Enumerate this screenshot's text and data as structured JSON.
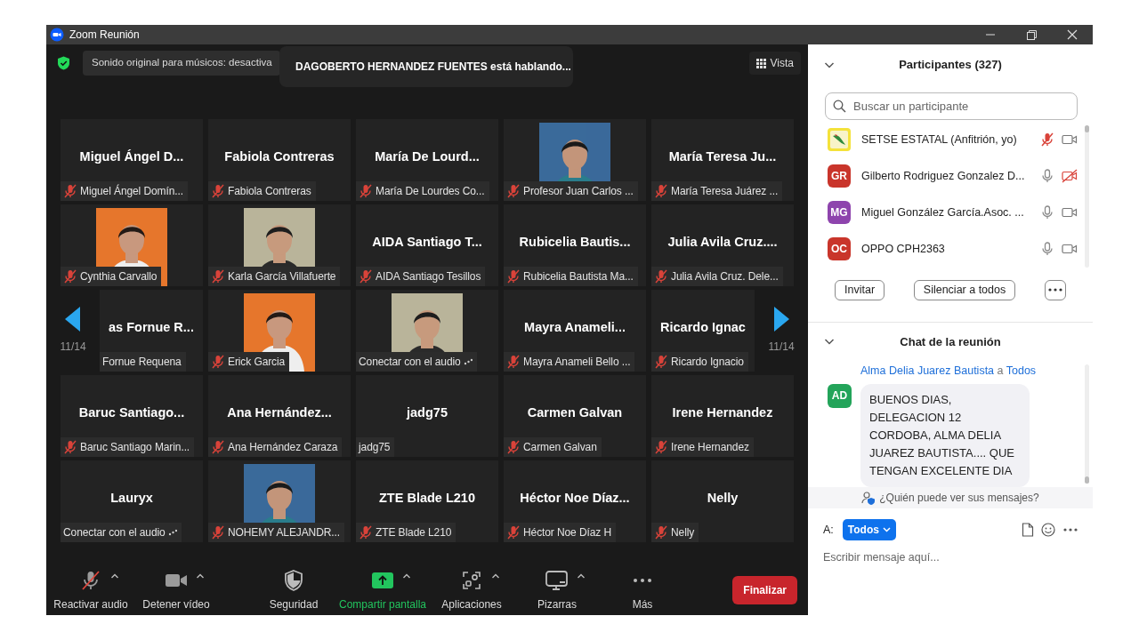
{
  "window": {
    "title": "Zoom Reunión"
  },
  "top_bar": {
    "banner": "Sonido original para músicos: desactiva",
    "speaking": "DAGOBERTO HERNANDEZ FUENTES está hablando...",
    "view_button": "Vista"
  },
  "gallery": {
    "page_prev": "11/14",
    "page_next": "11/14",
    "tiles": [
      {
        "kind": "name",
        "name": "Miguel Ángel D...",
        "label": "Miguel Ángel Domín...",
        "muted": true,
        "connecting": false
      },
      {
        "kind": "name",
        "name": "Fabiola Contreras",
        "label": "Fabiola Contreras",
        "muted": true,
        "connecting": false
      },
      {
        "kind": "name",
        "name": "María De Lourd...",
        "label": "María De Lourdes Co...",
        "muted": true,
        "connecting": false
      },
      {
        "kind": "picture",
        "label": "Profesor Juan Carlos ...",
        "muted": true,
        "connecting": false
      },
      {
        "kind": "name",
        "name": "María Teresa Ju...",
        "label": "María Teresa Juárez ...",
        "muted": true,
        "connecting": false
      },
      {
        "kind": "picture",
        "label": "Cynthia Carvallo",
        "muted": true,
        "connecting": false
      },
      {
        "kind": "picture",
        "label": "Karla García Villafuerte",
        "muted": true,
        "connecting": false
      },
      {
        "kind": "name",
        "name": "AIDA Santiago T...",
        "label": "AIDA Santiago Tesillos",
        "muted": true,
        "connecting": false
      },
      {
        "kind": "name",
        "name": "Rubicelia Bautis...",
        "label": "Rubicelia Bautista Ma...",
        "muted": true,
        "connecting": false
      },
      {
        "kind": "name",
        "name": "Julia Avila Cruz....",
        "label": "Julia Avila Cruz. Dele...",
        "muted": true,
        "connecting": false
      },
      {
        "kind": "name",
        "name": "as Fornue R...",
        "label": "Fornue Requena",
        "muted": false,
        "connecting": false,
        "clipped_left": true
      },
      {
        "kind": "picture",
        "label": "Erick Garcia",
        "muted": true,
        "connecting": false
      },
      {
        "kind": "picture",
        "label": "Conectar con el audio",
        "muted": false,
        "connecting": true
      },
      {
        "kind": "name",
        "name": "Mayra Anameli...",
        "label": "Mayra Anameli Bello ...",
        "muted": true,
        "connecting": false
      },
      {
        "kind": "name",
        "name": "Ricardo Ignac",
        "label": "Ricardo Ignacio",
        "muted": true,
        "connecting": false,
        "clipped_right": true
      },
      {
        "kind": "name",
        "name": "Baruc Santiago...",
        "label": "Baruc Santiago Marin...",
        "muted": true,
        "connecting": false
      },
      {
        "kind": "name",
        "name": "Ana Hernández...",
        "label": "Ana Hernández Caraza",
        "muted": true,
        "connecting": false
      },
      {
        "kind": "name",
        "name": "jadg75",
        "label": "jadg75",
        "muted": false,
        "connecting": false
      },
      {
        "kind": "name",
        "name": "Carmen Galvan",
        "label": "Carmen Galvan",
        "muted": true,
        "connecting": false
      },
      {
        "kind": "name",
        "name": "Irene Hernandez",
        "label": "Irene Hernandez",
        "muted": true,
        "connecting": false
      },
      {
        "kind": "name",
        "name": "Lauryx",
        "label": "Conectar con el audio",
        "muted": false,
        "connecting": true
      },
      {
        "kind": "picture",
        "label": "NOHEMY ALEJANDR...",
        "muted": true,
        "connecting": false
      },
      {
        "kind": "name",
        "name": "ZTE Blade L210",
        "label": "ZTE Blade L210",
        "muted": true,
        "connecting": false
      },
      {
        "kind": "name",
        "name": "Héctor Noe Díaz...",
        "label": "Héctor Noe Díaz H",
        "muted": true,
        "connecting": false
      },
      {
        "kind": "name",
        "name": "Nelly",
        "label": "Nelly",
        "muted": true,
        "connecting": false
      }
    ]
  },
  "toolbar": {
    "items": [
      {
        "kind": "audio",
        "label": "Reactivar audio",
        "muted": true,
        "caret": true
      },
      {
        "kind": "video",
        "label": "Detener vídeo",
        "caret": true
      },
      {
        "kind": "security",
        "label": "Seguridad",
        "caret": false
      },
      {
        "kind": "share",
        "label": "Compartir pantalla",
        "caret": true
      },
      {
        "kind": "apps",
        "label": "Aplicaciones",
        "caret": true
      },
      {
        "kind": "whiteboard",
        "label": "Pizarras",
        "caret": true
      },
      {
        "kind": "more",
        "label": "Más",
        "caret": false
      }
    ],
    "end_button": "Finalizar"
  },
  "participants": {
    "title": "Participantes (327)",
    "search": {
      "placeholder": "Buscar un participante"
    },
    "items": [
      {
        "name": "SETSE ESTATAL (Anfitrión, yo)",
        "avatar": {
          "kind": "logo"
        },
        "mic_muted": true,
        "video_on": true
      },
      {
        "name": "Gilberto Rodriguez Gonzalez D...",
        "avatar": {
          "kind": "initials",
          "text": "GR",
          "color": "#c9352b"
        },
        "mic_muted": false,
        "video_on": false
      },
      {
        "name": "Miguel González García.Asoc. ...",
        "avatar": {
          "kind": "initials",
          "text": "MG",
          "color": "#8e44ad"
        },
        "mic_muted": false,
        "video_on": true
      },
      {
        "name": "OPPO CPH2363",
        "avatar": {
          "kind": "initials",
          "text": "OC",
          "color": "#c9352b"
        },
        "mic_muted": false,
        "video_on": true
      }
    ],
    "buttons": [
      "Invitar",
      "Silenciar a todos"
    ]
  },
  "chat": {
    "title": "Chat de la reunión",
    "messages": [
      {
        "sender": "Alma Delia Juarez Bautista",
        "to_word": "a",
        "recipient": "Todos",
        "avatar": {
          "text": "AD",
          "color": "#23a45a"
        },
        "text": "BUENOS DIAS, DELEGACION 12 CORDOBA, ALMA DELIA JUAREZ BAUTISTA.... QUE TENGAN EXCELENTE DIA"
      }
    ],
    "visibility_note": "¿Quién puede ver sus mensajes?",
    "to_label": "A:",
    "recipient_button": "Todos",
    "placeholder": "Escribir mensaje aquí..."
  }
}
